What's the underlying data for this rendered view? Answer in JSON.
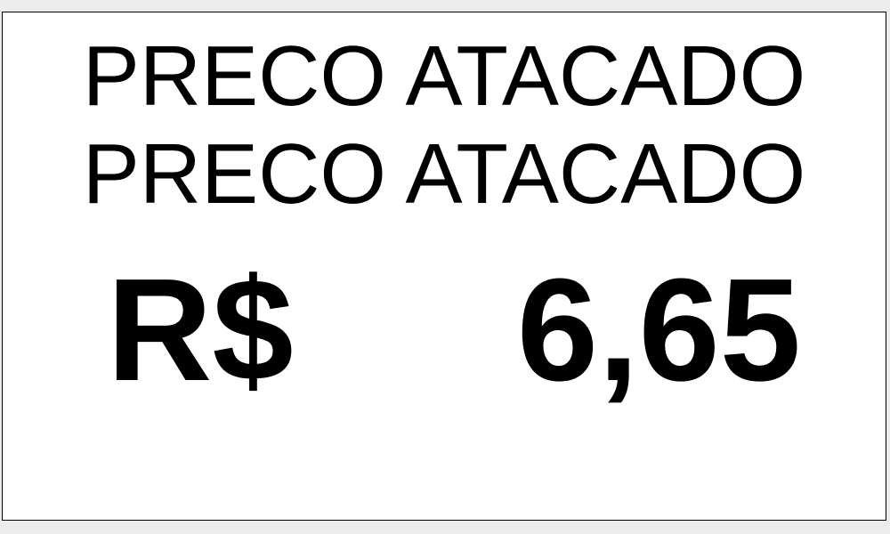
{
  "label": {
    "title_line_1": "PRECO ATACADO",
    "title_line_2": "PRECO ATACADO",
    "currency": "R$",
    "price": "6,65"
  },
  "colors": {
    "background": "#ececec",
    "label_background": "#ffffff",
    "text": "#000000",
    "border": "#000000"
  }
}
